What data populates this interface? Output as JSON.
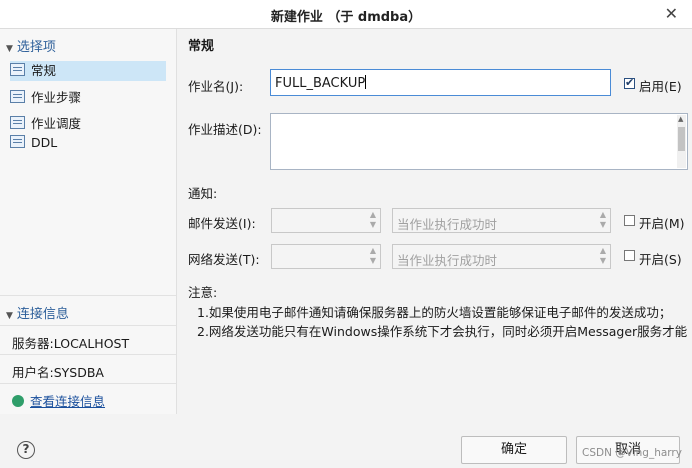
{
  "window": {
    "title": "新建作业  （于 dmdba）",
    "close_glyph": "✕"
  },
  "left": {
    "select_head": "选择项",
    "items": [
      "常规",
      "作业步骤",
      "作业调度",
      "DDL"
    ],
    "conn_head": "连接信息",
    "server": "服务器:LOCALHOST",
    "user": "用户名:SYSDBA",
    "view_conn": "查看连接信息"
  },
  "form": {
    "section": "常规",
    "name_label": "作业名(J):",
    "name_value": "FULL_BACKUP",
    "enable_label": "启用(E)",
    "desc_label": "作业描述(D):",
    "notify_label": "通知:",
    "email_label": "邮件发送(I):",
    "email_cond": "当作业执行成功时",
    "email_open": "开启(M)",
    "net_label": "网络发送(T):",
    "net_cond": "当作业执行成功时",
    "net_open": "开启(S)",
    "note_label": "注意:",
    "note1": "1.如果使用电子邮件通知请确保服务器上的防火墙设置能够保证电子邮件的发送成功；",
    "note2": "2.网络发送功能只有在Windows操作系统下才会执行，同时必须开启Messager服务才能"
  },
  "footer": {
    "help": "?",
    "ok": "确定",
    "cancel": "取消",
    "watermark": "CSDN @Ving_harry"
  },
  "colors": {
    "selected_bg": "#cde6f7",
    "link": "#1a4f9c",
    "section_head": "#2d5f9a"
  },
  "icons": [
    "close-icon",
    "collapse-triangle-icon",
    "page-icon",
    "connection-link-icon",
    "help-icon"
  ],
  "state": {
    "enable_checked": true,
    "email_open_checked": false,
    "net_open_checked": false
  }
}
